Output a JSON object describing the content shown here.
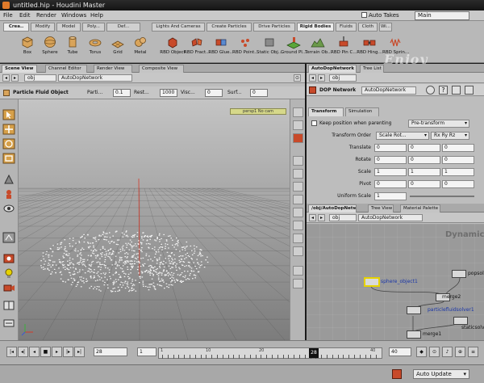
{
  "window": {
    "title": "untitled.hip - Houdini Master"
  },
  "menubar": {
    "items": [
      "File",
      "Edit",
      "Render",
      "Windows",
      "Help"
    ],
    "auto_takes_label": "Auto Takes",
    "desktop": "Main"
  },
  "shelf": {
    "left_tabs": [
      "Crea..",
      "Modify",
      "Model",
      "Poly...",
      "Def..."
    ],
    "right_tabs": [
      "Lights And Cameras",
      "Create Particles",
      "Drive Particles",
      "Rigid Bodies",
      "Fluids",
      "Cloth",
      "Wi..."
    ],
    "active_right_tab": "Rigid Bodies",
    "left_tools": [
      "Box",
      "Sphere",
      "Tube",
      "Torus",
      "Grid",
      "Metal"
    ],
    "right_tools": [
      "RBD Object",
      "RBD Fract...",
      "RBD Glue...",
      "RBD Point...",
      "Static Obj...",
      "Ground Pl...",
      "Terrain Ob...",
      "RBD Pin C...",
      "RBD Hing...",
      "RBD Sprin..."
    ]
  },
  "watermark": "Enjoy",
  "scene_pane": {
    "tabs": [
      "Scene View",
      "Channel Editor",
      "Render View",
      "Composite View"
    ],
    "path": "obj",
    "network": "AutoDopNetwork",
    "operator": {
      "title": "Particle Fluid Object",
      "fields": [
        {
          "label": "Parti...",
          "value": "0.1"
        },
        {
          "label": "Rest...",
          "value": "1000"
        },
        {
          "label": "Visc...",
          "value": "0"
        },
        {
          "label": "Surf...",
          "value": "0"
        }
      ]
    },
    "camera_label": "persp1  No cam"
  },
  "param_pane": {
    "tabs": [
      "AutoDopNetwork",
      "Tree List"
    ],
    "path": "obj",
    "type_label": "DOP Network",
    "node_name": "AutoDopNetwork",
    "sub_tabs": [
      "Transform",
      "Simulation"
    ],
    "keep_position_label": "Keep position when parenting",
    "pre_transform": "Pre-transform",
    "transform_order": {
      "label": "Transform Order",
      "value": "Scale Rot...",
      "rot": "Rx Ry Rz"
    },
    "rows": [
      {
        "label": "Translate",
        "values": [
          "0",
          "0",
          "0"
        ]
      },
      {
        "label": "Rotate",
        "values": [
          "0",
          "0",
          "0"
        ]
      },
      {
        "label": "Scale",
        "values": [
          "1",
          "1",
          "1"
        ]
      },
      {
        "label": "Pivot",
        "values": [
          "0",
          "0",
          "0"
        ]
      },
      {
        "label": "Uniform Scale",
        "values": [
          "1"
        ]
      }
    ]
  },
  "network_pane": {
    "tabs": [
      "/obj/AutoDopNetwork",
      "Tree View",
      "Material Palette"
    ],
    "path": "obj",
    "network": "AutoDopNetwork",
    "context_label": "Dynamics",
    "nodes": [
      {
        "name": "popsolver"
      },
      {
        "name": "sphere_object1"
      },
      {
        "name": "merge2"
      },
      {
        "name": "particlefluidsolver1"
      },
      {
        "name": "staticsolver"
      },
      {
        "name": "merge1"
      }
    ]
  },
  "timeline": {
    "start_frame": "28",
    "step": "1",
    "current_frame": "28",
    "end_frame": "40",
    "ruler_labels": [
      "1",
      "10",
      "20",
      "30",
      "40"
    ]
  },
  "status": {
    "update_mode": "Auto Update"
  }
}
